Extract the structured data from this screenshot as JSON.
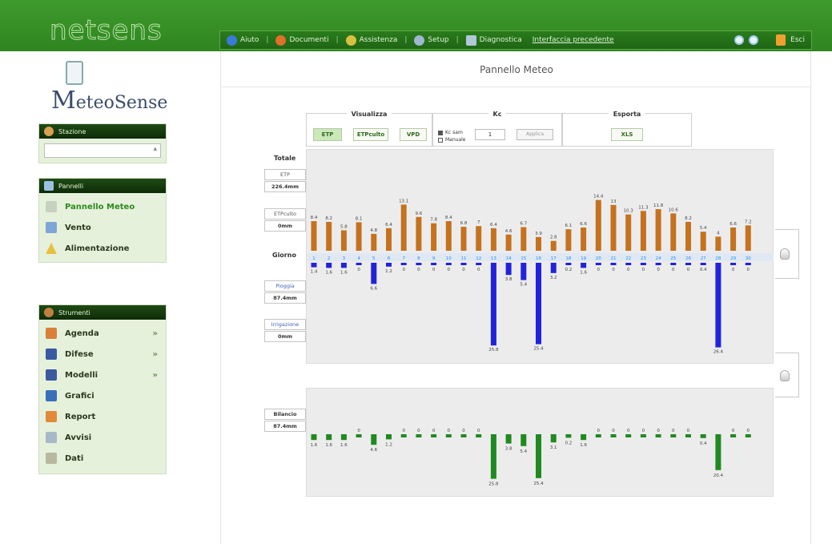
{
  "header": {
    "brand": "netsens",
    "menu": [
      {
        "label": "Aiuto",
        "icon": "help-icon",
        "color": "#3a7ad8"
      },
      {
        "label": "Documenti",
        "icon": "documents-icon",
        "color": "#e0702a"
      },
      {
        "label": "Assistenza",
        "icon": "support-icon",
        "color": "#d8c040"
      },
      {
        "label": "Setup",
        "icon": "tools-icon",
        "color": "#9fb8d0"
      },
      {
        "label": "Diagnostica",
        "icon": "diagnostics-icon",
        "color": "#b0c8d8"
      }
    ],
    "link": "Interfaccia precedente",
    "exit_label": "Esci"
  },
  "sidebar": {
    "logo_text_first": "M",
    "logo_text_rest": "eteoSense",
    "station_panel": {
      "title": "Stazione"
    },
    "panels_panel": {
      "title": "Pannelli",
      "items": [
        {
          "label": "Pannello Meteo",
          "icon": "antenna-icon",
          "active": true
        },
        {
          "label": "Vento",
          "icon": "chart-icon",
          "active": false
        },
        {
          "label": "Alimentazione",
          "icon": "warning-icon",
          "active": false
        }
      ]
    },
    "tools_panel": {
      "title": "Strumenti",
      "items": [
        {
          "label": "Agenda",
          "icon": "agenda-icon",
          "arrow": "»"
        },
        {
          "label": "Difese",
          "icon": "shield-icon",
          "arrow": "»"
        },
        {
          "label": "Modelli",
          "icon": "models-icon",
          "arrow": "»"
        },
        {
          "label": "Grafici",
          "icon": "graph-icon",
          "arrow": ""
        },
        {
          "label": "Report",
          "icon": "report-icon",
          "arrow": ""
        },
        {
          "label": "Avvisi",
          "icon": "alerts-icon",
          "arrow": ""
        },
        {
          "label": "Dati",
          "icon": "data-icon",
          "arrow": ""
        }
      ]
    }
  },
  "main": {
    "page_title": "Pannello Meteo",
    "controls": {
      "view_title": "Visualizza",
      "view_buttons": [
        "ETP",
        "ETPculto",
        "VPD"
      ],
      "kc_title": "Kc",
      "radio_options": [
        "Kc sam",
        "Manuale"
      ],
      "kc_value": "1",
      "apply_label": "Applica",
      "export_title": "Esporta",
      "export_button": "XLS"
    },
    "labels": {
      "totale": "Totale",
      "etp": "ETP",
      "etp_value": "226.4mm",
      "etpculto": "ETPculto",
      "etpculto_value": "0mm",
      "giorno": "Giorno",
      "pioggia": "Pioggia",
      "pioggia_value": "87.4mm",
      "irrigazione": "Irrigazione",
      "irrigazione_value": "0mm",
      "bilancio": "Bilancio",
      "bilancio_value": "87.4mm"
    }
  },
  "chart_data": [
    {
      "type": "bar",
      "name": "ETP",
      "categories": [
        "1",
        "2",
        "3",
        "4",
        "5",
        "6",
        "7",
        "8",
        "9",
        "10",
        "11",
        "12",
        "13",
        "14",
        "15",
        "16",
        "17",
        "18",
        "19",
        "20",
        "21",
        "22",
        "23",
        "24",
        "25",
        "26",
        "27",
        "28",
        "29",
        "30"
      ],
      "values": [
        8.4,
        8.2,
        5.8,
        8.1,
        4.8,
        6.4,
        13.1,
        9.6,
        7.8,
        8.4,
        6.8,
        7,
        6.4,
        4.6,
        6.7,
        3.9,
        2.8,
        6.1,
        6.6,
        14.4,
        13,
        10.3,
        11.3,
        11.8,
        10.6,
        8.2,
        5.4,
        4,
        6.6,
        7.2
      ],
      "color": "#c5721e"
    },
    {
      "type": "bar",
      "name": "Pioggia",
      "categories": [
        "1",
        "2",
        "3",
        "4",
        "5",
        "6",
        "7",
        "8",
        "9",
        "10",
        "11",
        "12",
        "13",
        "14",
        "15",
        "16",
        "17",
        "18",
        "19",
        "20",
        "21",
        "22",
        "23",
        "24",
        "25",
        "26",
        "27",
        "28",
        "29",
        "30"
      ],
      "values": [
        1.4,
        1.6,
        1.6,
        0,
        6.6,
        1.2,
        0,
        0,
        0,
        0,
        0,
        0,
        25.8,
        3.8,
        5.4,
        25.4,
        3.2,
        0.2,
        1.6,
        0,
        0,
        0,
        0,
        0,
        0,
        0,
        0.4,
        26.4,
        0,
        0
      ],
      "color": "#2222dd"
    },
    {
      "type": "bar",
      "name": "Bilancio",
      "categories": [
        "1",
        "2",
        "3",
        "4",
        "5",
        "6",
        "7",
        "8",
        "9",
        "10",
        "11",
        "12",
        "13",
        "14",
        "15",
        "16",
        "17",
        "18",
        "19",
        "20",
        "21",
        "22",
        "23",
        "24",
        "25",
        "26",
        "27",
        "28",
        "29",
        "30"
      ],
      "values": [
        1.6,
        1.6,
        1.6,
        0,
        4.6,
        1.2,
        0,
        0,
        0,
        0,
        0,
        0,
        25.8,
        3.8,
        5.4,
        25.4,
        3.1,
        0.2,
        1.6,
        0,
        0,
        0,
        0,
        0,
        0,
        0,
        0.4,
        20.4,
        0,
        0
      ],
      "color": "#1f8a1f"
    }
  ],
  "colors": {
    "brand_green": "#2f8520",
    "etp": "#c5721e",
    "rain": "#2222dd",
    "balance": "#1f8a1f",
    "day": "#1e90ff"
  }
}
